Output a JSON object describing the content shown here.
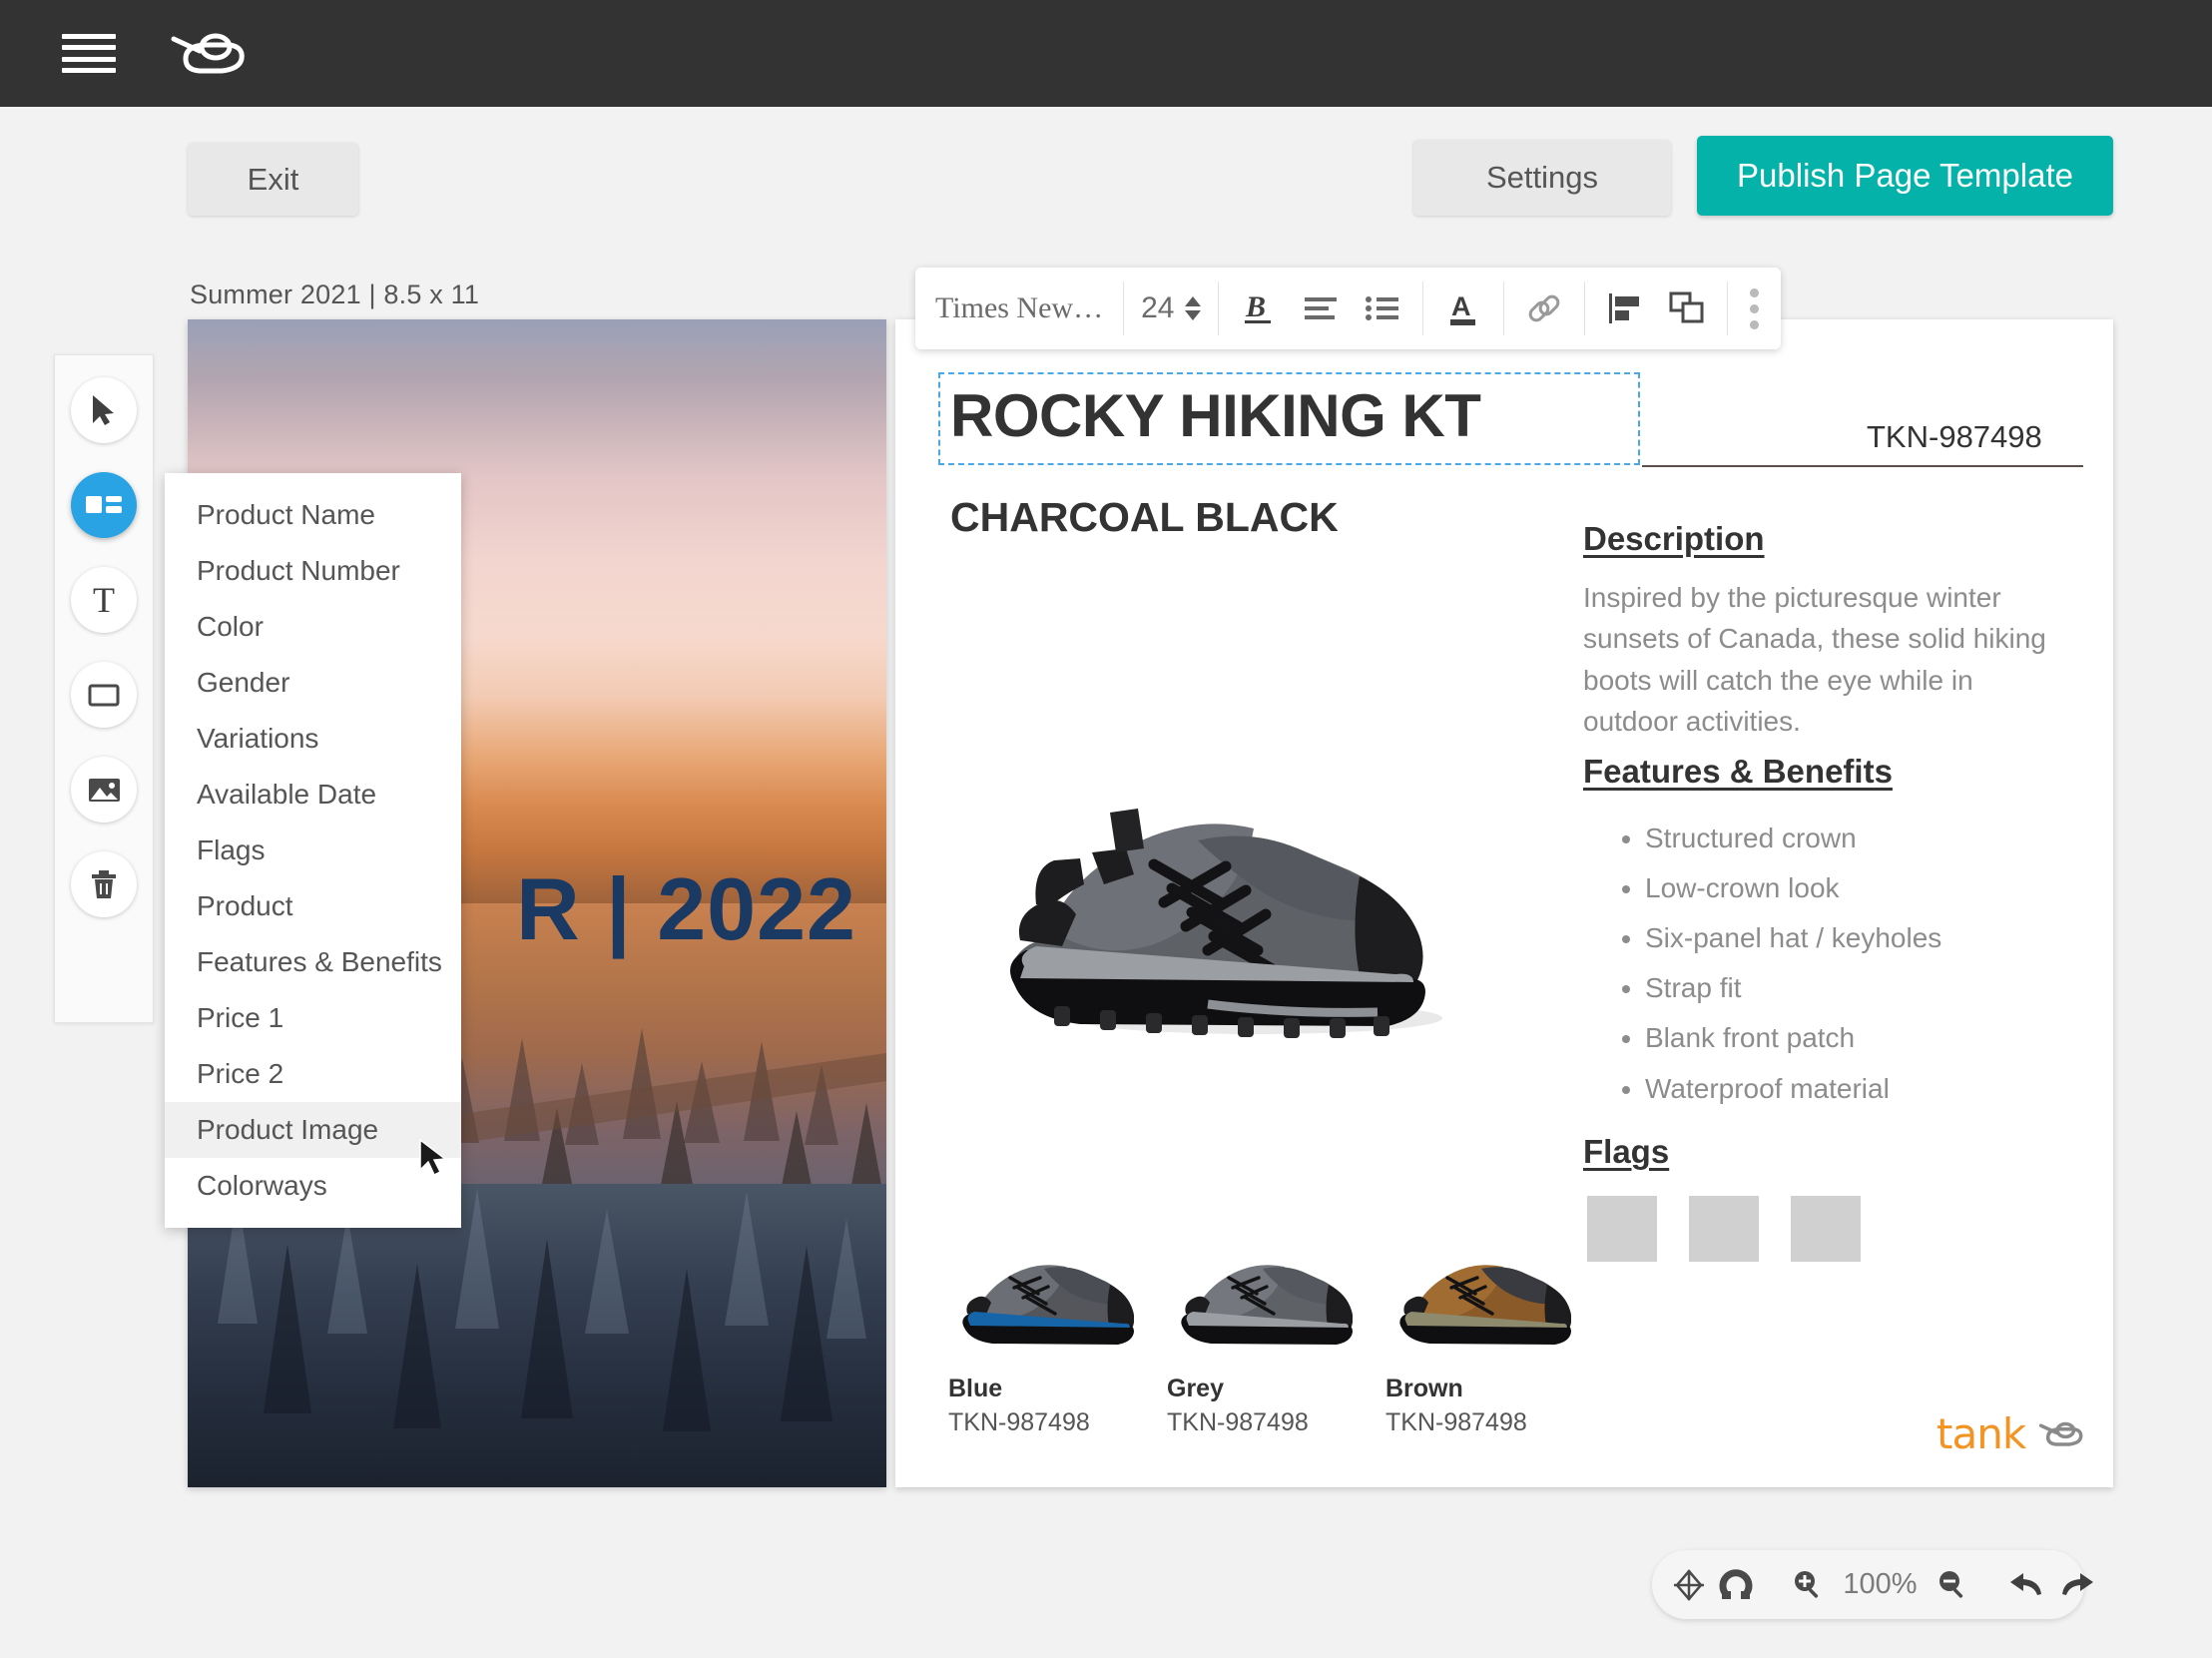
{
  "topbar": {
    "menu_icon": "hamburger-icon",
    "brand_icon": "tank-logo-icon"
  },
  "header": {
    "exit_label": "Exit",
    "settings_label": "Settings",
    "publish_label": "Publish Page Template",
    "publish_color": "#05b2aa"
  },
  "breadcrumb": "Summer 2021 |  8.5 x 11",
  "tools": [
    {
      "name": "select-tool",
      "icon": "cursor-icon",
      "active": false
    },
    {
      "name": "fields-tool",
      "icon": "layout-fields-icon",
      "active": true
    },
    {
      "name": "text-tool",
      "icon": "text-t-icon",
      "active": false
    },
    {
      "name": "shape-tool",
      "icon": "rectangle-icon",
      "active": false
    },
    {
      "name": "image-tool",
      "icon": "image-icon",
      "active": false
    },
    {
      "name": "delete-tool",
      "icon": "trash-icon",
      "active": false
    }
  ],
  "text_toolbar": {
    "font_family": "Times New…",
    "font_size": "24",
    "bold_icon": "bold-icon",
    "align_icon": "align-left-icon",
    "list_icon": "bulleted-list-icon",
    "font_color_icon": "font-color-icon",
    "link_icon": "link-icon",
    "align_objects_icon": "align-objects-icon",
    "arrange_icon": "arrange-layers-icon",
    "more_icon": "more-vertical-icon"
  },
  "dropdown": {
    "items": [
      {
        "label": "Product Name",
        "hovered": false
      },
      {
        "label": "Product Number",
        "hovered": false
      },
      {
        "label": "Color",
        "hovered": false
      },
      {
        "label": "Gender",
        "hovered": false
      },
      {
        "label": "Variations",
        "hovered": false
      },
      {
        "label": "Available Date",
        "hovered": false
      },
      {
        "label": "Flags",
        "hovered": false
      },
      {
        "label": "Product",
        "hovered": false
      },
      {
        "label": "Features & Benefits",
        "hovered": false
      },
      {
        "label": "Price 1",
        "hovered": false
      },
      {
        "label": "Price 2",
        "hovered": false
      },
      {
        "label": "Product Image",
        "hovered": true
      },
      {
        "label": "Colorways",
        "hovered": false
      }
    ]
  },
  "cover_page": {
    "year_text": "R | 2022",
    "year_color": "#1b3a63"
  },
  "document": {
    "title": "ROCKY HIKING KT",
    "sku": "TKN-987498",
    "color_name": "CHARCOAL BLACK",
    "description_heading": "Description",
    "description_body": "Inspired by the picturesque winter sunsets of Canada, these solid hiking boots will catch the eye while in outdoor activities.",
    "features_heading": "Features & Benefits",
    "features": [
      "Structured crown",
      "Low-crown look",
      "Six-panel hat / keyholes",
      "Strap fit",
      "Blank front patch",
      "Waterproof material"
    ],
    "flags_heading": "Flags",
    "flags_count": 3,
    "flag_color": "#d0d0d0",
    "colorways": [
      {
        "name": "Blue",
        "sku": "TKN-987498"
      },
      {
        "name": "Grey",
        "sku": "TKN-987498"
      },
      {
        "name": "Brown",
        "sku": "TKN-987498"
      }
    ],
    "watermark": "tank"
  },
  "zoombar": {
    "snap_grid_icon": "snap-grid-icon",
    "magnet_icon": "magnet-icon",
    "zoom_in_icon": "zoom-in-icon",
    "zoom_level": "100%",
    "zoom_out_icon": "zoom-out-icon",
    "undo_icon": "undo-icon",
    "redo_icon": "redo-icon"
  }
}
